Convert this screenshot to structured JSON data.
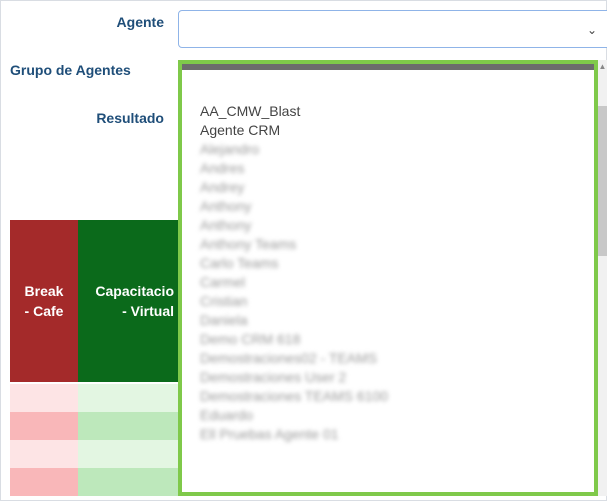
{
  "form": {
    "agente_label": "Agente",
    "grupo_label": "Grupo de Agentes",
    "resultado_label": "Resultado",
    "agente_value": ""
  },
  "table": {
    "headers": [
      {
        "line1": "Break",
        "line2": "- Cafe",
        "color": "#a42a2a"
      },
      {
        "line1": "Capacitacio",
        "line2": "- Virtual",
        "color": "#0b6a1b"
      }
    ],
    "rows_colors": [
      {
        "break": "#fde4e5",
        "cap": "#e3f6e2"
      },
      {
        "break": "#f9b7b9",
        "cap": "#bde8bb"
      },
      {
        "break": "#fde4e5",
        "cap": "#e3f6e2"
      },
      {
        "break": "#f9b7b9",
        "cap": "#bde8bb"
      }
    ]
  },
  "dropdown": {
    "items": [
      {
        "text": "AA_CMW_Blast",
        "blur": false
      },
      {
        "text": "Agente CRM",
        "blur": false
      },
      {
        "text": "Alejandro",
        "blur": true
      },
      {
        "text": "Andres",
        "blur": true
      },
      {
        "text": "Andrey",
        "blur": true
      },
      {
        "text": "Anthony",
        "blur": true
      },
      {
        "text": "Anthony",
        "blur": true
      },
      {
        "text": "Anthony Teams",
        "blur": true
      },
      {
        "text": "Carlo Teams",
        "blur": true
      },
      {
        "text": "Carmel",
        "blur": true
      },
      {
        "text": "Cristian",
        "blur": true
      },
      {
        "text": "Daniela",
        "blur": true
      },
      {
        "text": "Demo CRM 618",
        "blur": true
      },
      {
        "text": "Demostraciones02 - TEAMS",
        "blur": true
      },
      {
        "text": "Demostraciones User 2",
        "blur": true
      },
      {
        "text": "Demostraciones TEAMS 6100",
        "blur": true
      },
      {
        "text": "Eduardo",
        "blur": true
      },
      {
        "text": "Ell Pruebas Agente 01",
        "blur": true
      }
    ]
  }
}
